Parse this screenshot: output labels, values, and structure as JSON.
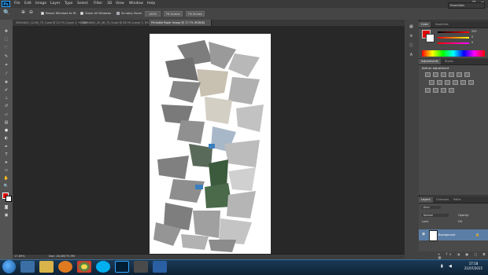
{
  "app": {
    "logo": "Ps"
  },
  "menu": [
    "File",
    "Edit",
    "Image",
    "Layer",
    "Type",
    "Select",
    "Filter",
    "3D",
    "View",
    "Window",
    "Help"
  ],
  "window_controls": {
    "minimize": "–",
    "restore": "❐",
    "close": "✕"
  },
  "options_bar": {
    "resize_windows_label": "Resize Windows to Fit",
    "zoom_all_label": "Zoom All Windows",
    "scrubby_zoom_label": "Scrubby Zoom",
    "zoom_100_label": "100%",
    "fit_screen_label": "Fit Screen",
    "fill_screen_label": "Fill Screen",
    "workspace": "Essentials"
  },
  "tabs": [
    {
      "label": "3SeSdb01_12.0ft_75_3.psb @ 23.7% (Layer 1, RGB/8)",
      "active": false
    },
    {
      "label": "3SeSdb02_20_4ft_75_3.psb @ 28.9% (Layer 1, RGB/8)",
      "active": false
    },
    {
      "label": "Printable Paper Image @ 17.7% (RGB/8)",
      "active": true
    }
  ],
  "status": {
    "zoom": "17.69%",
    "doc": "Doc: 28.4M/75.9M"
  },
  "color_panel": {
    "tabs": [
      "Color",
      "Swatches"
    ],
    "fg_color": "#e00000",
    "r_value": "255",
    "g_value": "0",
    "b_value": "0"
  },
  "adjustments_panel": {
    "tabs": [
      "Adjustments",
      "Styles"
    ],
    "title": "Add an adjustment"
  },
  "layers_panel": {
    "tabs": [
      "Layers",
      "Channels",
      "Paths"
    ],
    "kind_label": "Kind",
    "blend_mode": "Normal",
    "opacity_label": "Opacity:",
    "fill_label": "Fill:",
    "lock_label": "Lock:",
    "layer_name": "Background"
  },
  "taskbar": {
    "time": "17:18",
    "date": "21/07/2015"
  }
}
